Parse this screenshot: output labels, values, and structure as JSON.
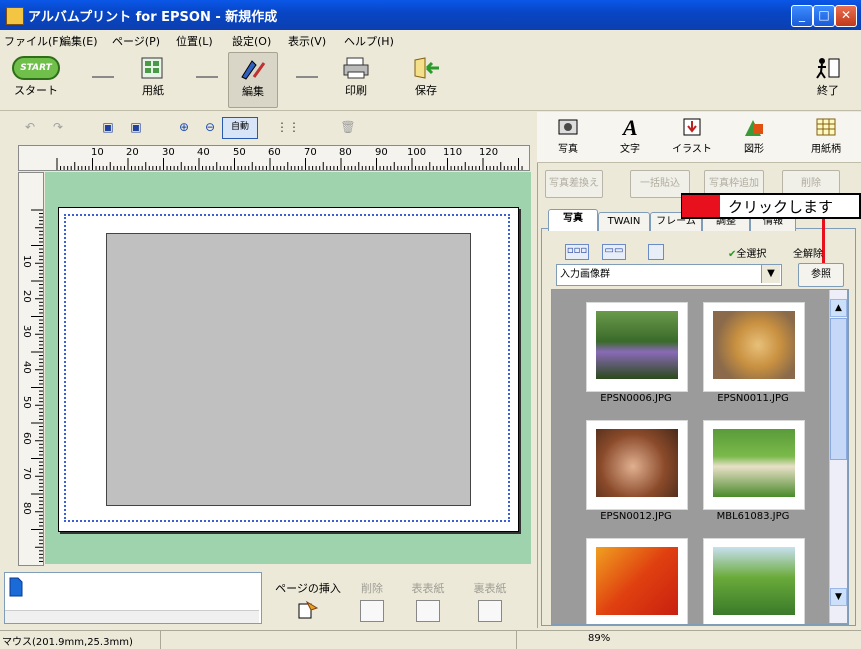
{
  "window": {
    "title": "アルバムプリント for EPSON - 新規作成"
  },
  "menu": [
    "ファイル(F)",
    "編集(E)",
    "ページ(P)",
    "位置(L)",
    "設定(O)",
    "表示(V)",
    "ヘルプ(H)"
  ],
  "toolbar": {
    "start_badge": "START",
    "start_label": "スタート",
    "paper_label": "用紙",
    "edit_label": "編集",
    "print_label": "印刷",
    "save_label": "保存",
    "exit_label": "終了"
  },
  "subtoolbar": {
    "auto_label": "自動"
  },
  "ruler": {
    "h_ticks": [
      "10",
      "20",
      "30",
      "40",
      "50",
      "60",
      "70",
      "80",
      "90",
      "100",
      "110",
      "120"
    ],
    "v_ticks": [
      "10",
      "20",
      "30",
      "40",
      "50",
      "60",
      "70",
      "80"
    ]
  },
  "bottom": {
    "insert_page_label": "ページの挿入",
    "delete_label": "削除",
    "front_label": "表表紙",
    "back_label": "裏表紙"
  },
  "status": {
    "mouse": "マウス(201.9mm,25.3mm)",
    "zoom": "89%"
  },
  "right_tools": [
    "写真",
    "文字",
    "イラスト",
    "図形",
    "用紙柄"
  ],
  "photo_buttons": [
    "写真差換え",
    "一括貼込",
    "写真枠追加",
    "削除"
  ],
  "tabs": [
    "写真",
    "TWAIN",
    "フレーム",
    "調整",
    "情報"
  ],
  "callout": "クリックします",
  "selection": {
    "select_all": "全選択",
    "deselect": "全解除"
  },
  "source": {
    "value": "入力画像群",
    "browse_label": "参照"
  },
  "photos": [
    {
      "name": "EPSN0006.JPG"
    },
    {
      "name": "EPSN0011.JPG"
    },
    {
      "name": "EPSN0012.JPG"
    },
    {
      "name": "MBL61083.JPG"
    }
  ],
  "colors": {
    "titlebar": "#0846c6",
    "canvas": "#9fd3ad",
    "accent_red": "#e8101c"
  }
}
